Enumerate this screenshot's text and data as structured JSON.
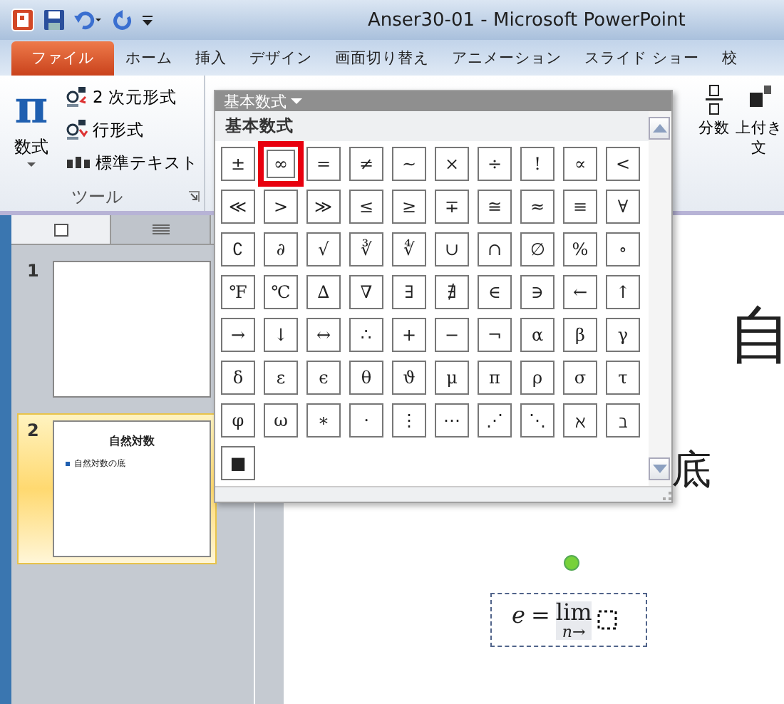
{
  "window": {
    "title": "Anser30-01  -  Microsoft PowerPoint"
  },
  "tabs": [
    {
      "label": "ファイル",
      "kind": "file",
      "selected": false
    },
    {
      "label": "ホーム",
      "kind": "tab",
      "selected": false
    },
    {
      "label": "挿入",
      "kind": "tab",
      "selected": false
    },
    {
      "label": "デザイン",
      "kind": "tab",
      "selected": false
    },
    {
      "label": "画面切り替え",
      "kind": "tab",
      "selected": false
    },
    {
      "label": "アニメーション",
      "kind": "tab",
      "selected": false
    },
    {
      "label": "スライド ショー",
      "kind": "tab",
      "selected": false
    },
    {
      "label": "校",
      "kind": "tab",
      "selected": false
    }
  ],
  "ribbon": {
    "equation_button": {
      "icon": "π",
      "label": "数式"
    },
    "tools": [
      {
        "label": "2 次元形式",
        "kind": "professional"
      },
      {
        "label": "行形式",
        "kind": "linear"
      },
      {
        "label": "標準テキスト",
        "kind": "text"
      }
    ],
    "group_label": "ツール",
    "right_buttons": [
      {
        "label": "分数",
        "kind": "fraction"
      },
      {
        "label": "上付き",
        "label_2": "文",
        "kind": "script"
      }
    ]
  },
  "gallery": {
    "header": "基本数式",
    "section": "基本数式",
    "symbols": [
      {
        "text": "±",
        "selected": false
      },
      {
        "text": "∞",
        "selected": true
      },
      {
        "text": "=",
        "selected": false
      },
      {
        "text": "≠",
        "selected": false
      },
      {
        "text": "~",
        "selected": false
      },
      {
        "text": "×",
        "selected": false
      },
      {
        "text": "÷",
        "selected": false
      },
      {
        "text": "!",
        "selected": false
      },
      {
        "text": "∝",
        "selected": false
      },
      {
        "text": "<",
        "selected": false
      },
      {
        "text": "≪",
        "selected": false
      },
      {
        "text": ">",
        "selected": false
      },
      {
        "text": "≫",
        "selected": false
      },
      {
        "text": "≤",
        "selected": false
      },
      {
        "text": "≥",
        "selected": false
      },
      {
        "text": "∓",
        "selected": false
      },
      {
        "text": "≅",
        "selected": false
      },
      {
        "text": "≈",
        "selected": false
      },
      {
        "text": "≡",
        "selected": false
      },
      {
        "text": "∀",
        "selected": false
      },
      {
        "text": "∁",
        "selected": false
      },
      {
        "text": "∂",
        "selected": false
      },
      {
        "text": "√",
        "selected": false
      },
      {
        "text": "∛",
        "selected": false
      },
      {
        "text": "∜",
        "selected": false
      },
      {
        "text": "∪",
        "selected": false
      },
      {
        "text": "∩",
        "selected": false
      },
      {
        "text": "∅",
        "selected": false
      },
      {
        "text": "%",
        "selected": false
      },
      {
        "text": "∘",
        "selected": false
      },
      {
        "text": "℉",
        "selected": false
      },
      {
        "text": "℃",
        "selected": false
      },
      {
        "text": "∆",
        "selected": false
      },
      {
        "text": "∇",
        "selected": false
      },
      {
        "text": "∃",
        "selected": false
      },
      {
        "text": "∄",
        "selected": false
      },
      {
        "text": "∈",
        "selected": false
      },
      {
        "text": "∋",
        "selected": false
      },
      {
        "text": "←",
        "selected": false
      },
      {
        "text": "↑",
        "selected": false
      },
      {
        "text": "→",
        "selected": false
      },
      {
        "text": "↓",
        "selected": false
      },
      {
        "text": "↔",
        "selected": false
      },
      {
        "text": "∴",
        "selected": false
      },
      {
        "text": "+",
        "selected": false
      },
      {
        "text": "−",
        "selected": false
      },
      {
        "text": "¬",
        "selected": false
      },
      {
        "text": "α",
        "selected": false
      },
      {
        "text": "β",
        "selected": false
      },
      {
        "text": "γ",
        "selected": false
      },
      {
        "text": "δ",
        "selected": false
      },
      {
        "text": "ε",
        "selected": false
      },
      {
        "text": "ϵ",
        "selected": false
      },
      {
        "text": "θ",
        "selected": false
      },
      {
        "text": "ϑ",
        "selected": false
      },
      {
        "text": "μ",
        "selected": false
      },
      {
        "text": "π",
        "selected": false
      },
      {
        "text": "ρ",
        "selected": false
      },
      {
        "text": "σ",
        "selected": false
      },
      {
        "text": "τ",
        "selected": false
      },
      {
        "text": "φ",
        "selected": false
      },
      {
        "text": "ω",
        "selected": false
      },
      {
        "text": "∗",
        "selected": false
      },
      {
        "text": "⋅",
        "selected": false
      },
      {
        "text": "⋮",
        "selected": false
      },
      {
        "text": "⋯",
        "selected": false
      },
      {
        "text": "⋰",
        "selected": false
      },
      {
        "text": "⋱",
        "selected": false
      },
      {
        "text": "ℵ",
        "selected": false
      },
      {
        "text": "ℶ",
        "selected": false
      },
      {
        "text": "■",
        "selected": false
      }
    ]
  },
  "slides": [
    {
      "number": "1",
      "selected": false
    },
    {
      "number": "2",
      "selected": true,
      "title": "自然対数",
      "bullet": "自然対数の底"
    }
  ],
  "slide": {
    "title": "自",
    "text": "底"
  },
  "equation": {
    "lhs": "e",
    "op": "=",
    "func": "lim",
    "sub": "n→"
  }
}
